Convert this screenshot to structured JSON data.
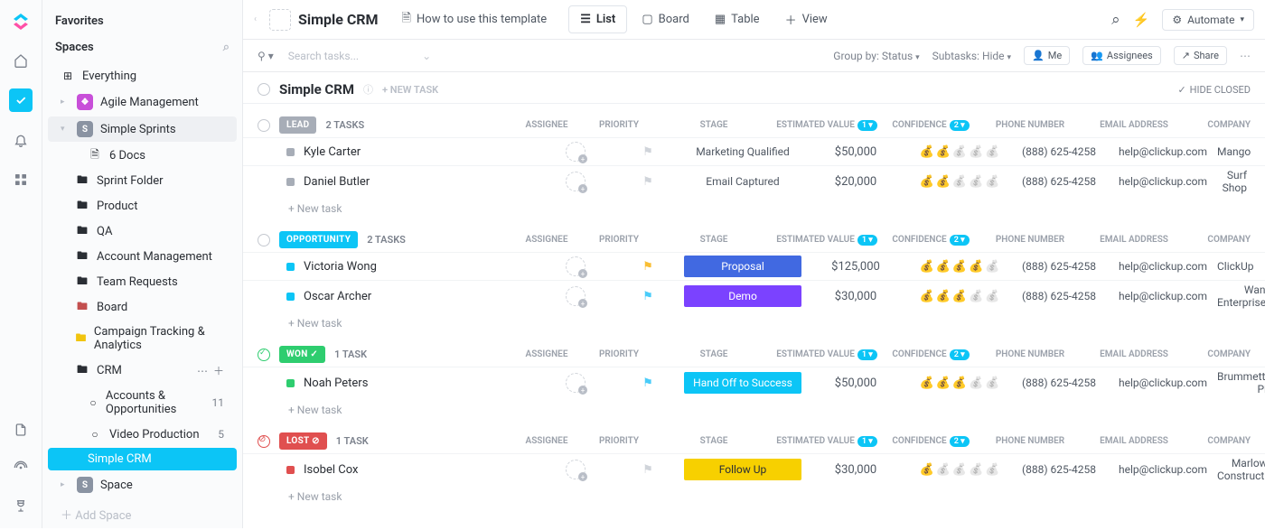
{
  "sidebar": {
    "favorites": "Favorites",
    "spaces": "Spaces",
    "everything": "Everything",
    "agile": "Agile Management",
    "sprints": "Simple Sprints",
    "docs": "6 Docs",
    "sprint_folder": "Sprint Folder",
    "product": "Product",
    "qa": "QA",
    "account_mgmt": "Account Management",
    "team_req": "Team Requests",
    "board": "Board",
    "campaign": "Campaign Tracking & Analytics",
    "crm": "CRM",
    "accounts_opp": "Accounts & Opportunities",
    "accounts_opp_count": "11",
    "video_prod": "Video Production",
    "video_prod_count": "5",
    "simple_crm": "Simple CRM",
    "space": "Space",
    "add_space": "Add Space"
  },
  "topbar": {
    "title": "Simple CRM",
    "howto": "How to use this template",
    "list": "List",
    "board": "Board",
    "table": "Table",
    "view": "View",
    "automate": "Automate"
  },
  "filterbar": {
    "search": "Search tasks...",
    "groupby": "Group by: Status",
    "subtasks": "Subtasks: Hide",
    "me": "Me",
    "assignees": "Assignees",
    "share": "Share"
  },
  "section": {
    "title": "Simple CRM",
    "newtask": "+ NEW TASK",
    "hideclosed": "HIDE CLOSED"
  },
  "cols": {
    "assignee": "ASSIGNEE",
    "priority": "PRIORITY",
    "stage": "STAGE",
    "est": "ESTIMATED VALUE",
    "conf": "CONFIDENCE",
    "phone": "PHONE NUMBER",
    "email": "EMAIL ADDRESS",
    "company": "COMPANY"
  },
  "labels": {
    "newtask": "+ New task"
  },
  "groups": [
    {
      "name": "LEAD",
      "color": "#a7adb7",
      "count": "2 TASKS",
      "dot": "#a7adb7",
      "circ": "plain",
      "tasks": [
        {
          "name": "Kyle Carter",
          "stage": "Marketing Qualified",
          "stageClass": "plain",
          "flag": "",
          "value": "$50,000",
          "conf": 2,
          "phone": "(888) 625-4258",
          "email": "help@clickup.com",
          "company": "Mango"
        },
        {
          "name": "Daniel Butler",
          "stage": "Email Captured",
          "stageClass": "plain",
          "flag": "",
          "value": "$20,000",
          "conf": 2,
          "phone": "(888) 625-4258",
          "email": "help@clickup.com",
          "company": "Surf Shop"
        }
      ]
    },
    {
      "name": "OPPORTUNITY",
      "color": "#0cc5f6",
      "count": "2 TASKS",
      "dot": "#0cc5f6",
      "circ": "plain",
      "tasks": [
        {
          "name": "Victoria Wong",
          "stage": "Proposal",
          "stageClass": "blue",
          "flag": "flag-y",
          "value": "$125,000",
          "conf": 4,
          "phone": "(888) 625-4258",
          "email": "help@clickup.com",
          "company": "ClickUp"
        },
        {
          "name": "Oscar Archer",
          "stage": "Demo",
          "stageClass": "purple",
          "flag": "flag-c",
          "value": "$30,000",
          "conf": 3,
          "phone": "(888) 625-4258",
          "email": "help@clickup.com",
          "company": "Wang Enterprises"
        }
      ]
    },
    {
      "name": "WON",
      "color": "#2ecd6f",
      "count": "1 TASK",
      "dot": "#2ecd6f",
      "circ": "green",
      "tasks": [
        {
          "name": "Noah Peters",
          "stage": "Hand Off to Success",
          "stageClass": "cyan",
          "flag": "flag-c",
          "value": "$50,000",
          "conf": 3,
          "phone": "(888) 625-4258",
          "email": "help@clickup.com",
          "company": "Brummette's Pies"
        }
      ]
    },
    {
      "name": "LOST",
      "color": "#e04f4f",
      "count": "1 TASK",
      "dot": "#e04f4f",
      "circ": "red",
      "tasks": [
        {
          "name": "Isobel Cox",
          "stage": "Follow Up",
          "stageClass": "yellow",
          "flag": "",
          "value": "$30,000",
          "conf": 1,
          "phone": "(888) 625-4258",
          "email": "help@clickup.com",
          "company": "Marlowe Constructio"
        }
      ]
    }
  ]
}
